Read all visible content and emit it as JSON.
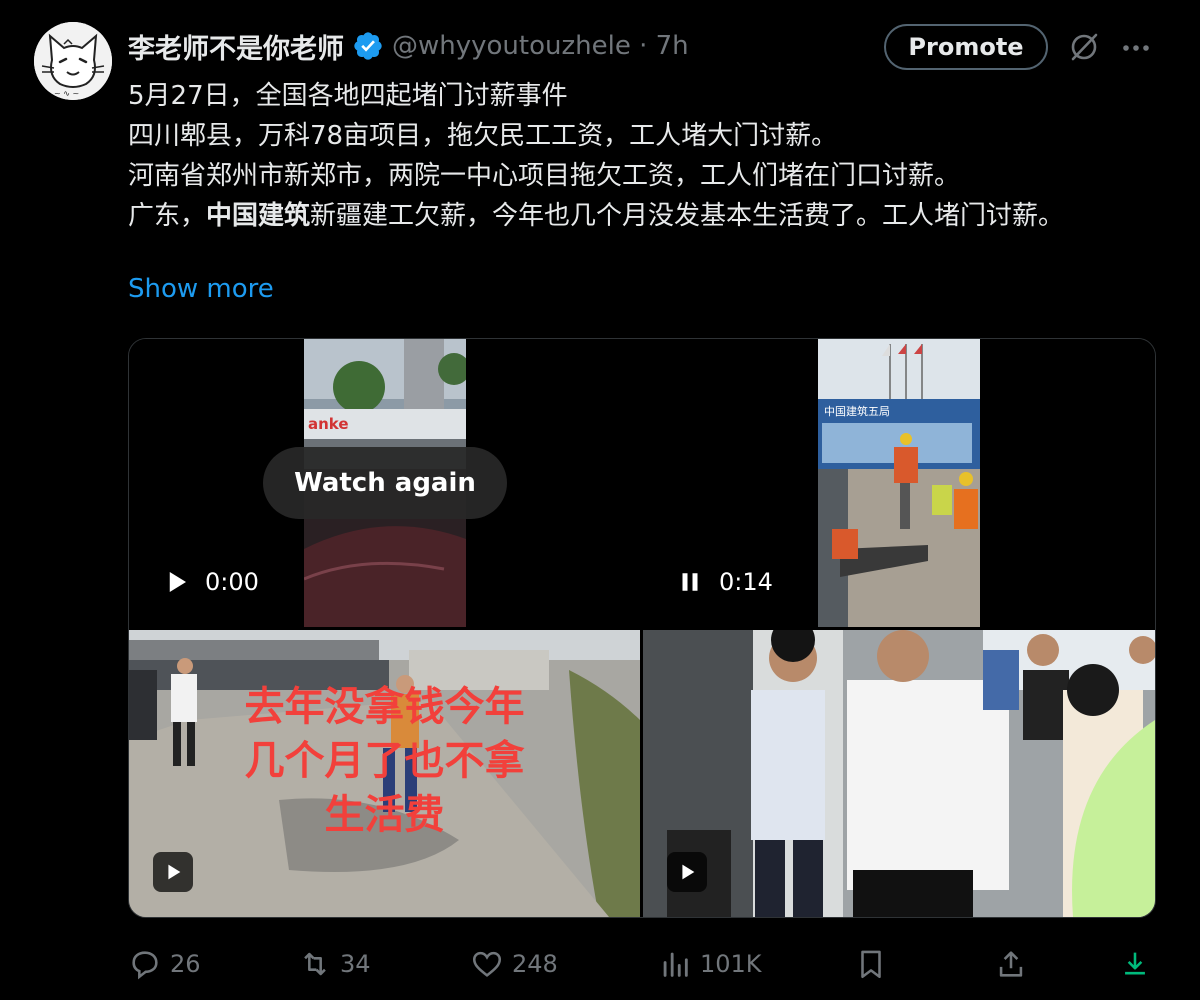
{
  "author": {
    "display_name": "李老师不是你老师",
    "handle_time": "@whyyoutouzhele · 7h",
    "avatar_icon": "cat-doodle-avatar",
    "verified_icon": "verified-badge-icon"
  },
  "header": {
    "promote_label": "Promote",
    "grok_icon": "grok-icon",
    "more_icon": "more-icon"
  },
  "tweet": {
    "lines": [
      "5月27日，全国各地四起堵门讨薪事件",
      "四川郫县，万科78亩项目，拖欠民工工资，工人堵大门讨薪。",
      "河南省郑州市新郑市，两院一中心项目拖欠工资，工人们堵在门口讨薪。"
    ],
    "line4_prefix": "广东，",
    "line4_bold": "中国建筑",
    "line4_suffix": "新疆建工欠薪，今年也几个月没发基本生活费了。工人堵门讨薪。",
    "show_more": "Show more"
  },
  "media": {
    "video1": {
      "watch_again": "Watch again",
      "time": "0:00",
      "sign_text": "anke"
    },
    "video2": {
      "time": "0:14",
      "sign_text": "中国建筑五局"
    },
    "video3": {
      "caption_line1": "去年没拿钱今年",
      "caption_line2": "几个月了也不拿",
      "caption_line3": "生活费"
    },
    "video4": {}
  },
  "actions": {
    "replies": "26",
    "reposts": "34",
    "likes": "248",
    "views": "101K"
  },
  "colors": {
    "background": "#000000",
    "text": "#e7e9ea",
    "muted": "#71767b",
    "link": "#1d9bf0",
    "verified": "#1d9bf0",
    "download": "#00ba7c",
    "caption_red": "#f2403b"
  }
}
